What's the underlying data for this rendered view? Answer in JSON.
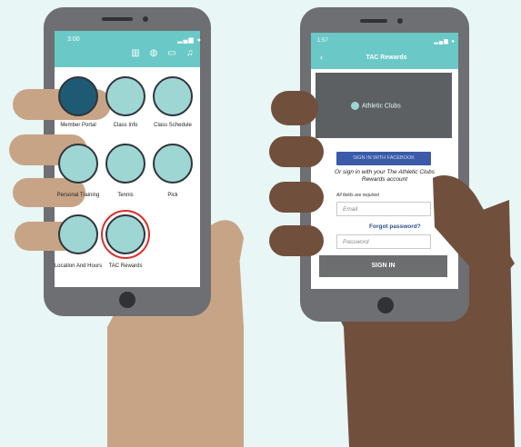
{
  "left_phone": {
    "status_time": "3:00",
    "status_icons": "▂▄▆ ●",
    "apps": [
      {
        "label": "Member Portal",
        "icon": "swimmer-icon"
      },
      {
        "label": "Class Info",
        "icon": "group-icon"
      },
      {
        "label": "Class Schedule",
        "icon": "calendar-icon"
      },
      {
        "label": "Personal Training",
        "icon": "dumbbell-icon"
      },
      {
        "label": "Tennis",
        "icon": "tennis-racket-icon"
      },
      {
        "label": "Pick",
        "icon": "pickleball-paddle-icon"
      },
      {
        "label": "Location And Hours",
        "icon": "clock-location-icon"
      },
      {
        "label": "TAC Rewards",
        "icon": "gift-icon"
      }
    ]
  },
  "right_phone": {
    "status_time": "1:57",
    "status_icons": "▂▄▆ ●",
    "title": "TAC Rewards",
    "back_icon": "chevron-left-icon",
    "brand": "Athletic Clubs",
    "facebook_button": "SIGN IN WITH FACEBOOK",
    "alt_signin_text": "Or sign in with your The Athletic Clubs Rewards account",
    "required_note": "All fields are required",
    "email_placeholder": "Email",
    "forgot_password": "Forgot password?",
    "password_placeholder": "Password",
    "signin_button": "SIGN IN"
  },
  "colors": {
    "background": "#e8f6f5",
    "teal": "#6ac9c6",
    "phone_body": "#6e6f72",
    "light_skin": "#c8a487",
    "dark_skin": "#714f3d",
    "facebook_blue": "#3b5aa8",
    "highlight_red": "#d9302c"
  }
}
